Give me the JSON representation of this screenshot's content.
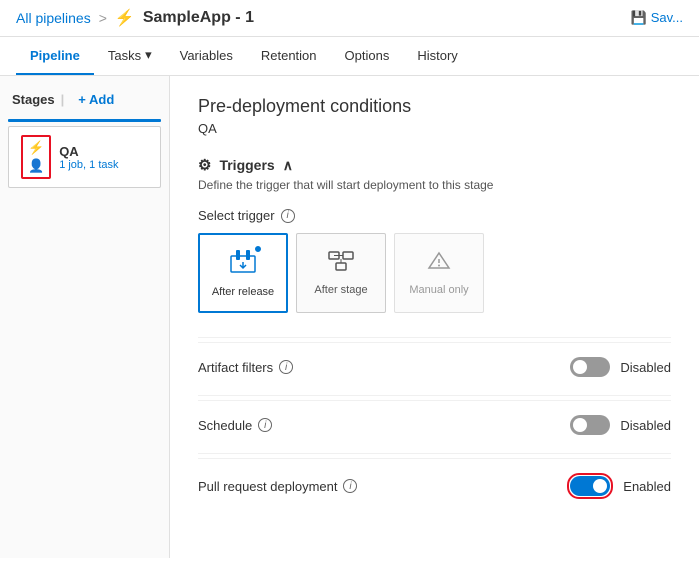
{
  "topbar": {
    "breadcrumb_link": "All pipelines",
    "breadcrumb_sep": ">",
    "app_icon": "⚡",
    "app_name": "SampleApp - 1",
    "save_label": "Sav..."
  },
  "nav": {
    "tabs": [
      {
        "id": "pipeline",
        "label": "Pipeline",
        "active": true
      },
      {
        "id": "tasks",
        "label": "Tasks",
        "has_arrow": true
      },
      {
        "id": "variables",
        "label": "Variables"
      },
      {
        "id": "retention",
        "label": "Retention"
      },
      {
        "id": "options",
        "label": "Options"
      },
      {
        "id": "history",
        "label": "History"
      }
    ]
  },
  "sidebar": {
    "stages_label": "Stages",
    "add_label": "+ Add",
    "stage": {
      "name": "QA",
      "meta": "1 job, 1 task"
    }
  },
  "content": {
    "page_title": "Pre-deployment conditions",
    "page_subtitle": "QA",
    "triggers_heading": "Triggers",
    "triggers_icon": "⚙",
    "triggers_desc": "Define the trigger that will start deployment to this stage",
    "select_trigger_label": "Select trigger",
    "trigger_options": [
      {
        "id": "after-release",
        "label": "After\nrelease",
        "icon": "🏢",
        "selected": true
      },
      {
        "id": "after-stage",
        "label": "After\nstage",
        "icon": "☰"
      },
      {
        "id": "manual-only",
        "label": "Manual\nonly",
        "icon": "⚡",
        "disabled": true
      }
    ],
    "options": [
      {
        "id": "artifact-filters",
        "label": "Artifact filters",
        "status": "Disabled",
        "enabled": false,
        "highlight": false
      },
      {
        "id": "schedule",
        "label": "Schedule",
        "status": "Disabled",
        "enabled": false,
        "highlight": false
      },
      {
        "id": "pull-request-deployment",
        "label": "Pull request deployment",
        "status": "Enabled",
        "enabled": true,
        "highlight": true
      }
    ]
  }
}
